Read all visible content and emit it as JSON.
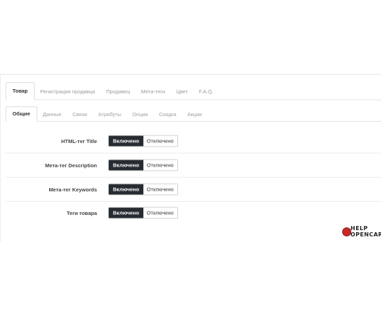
{
  "top_tabs": [
    {
      "label": "Товар",
      "active": true
    },
    {
      "label": "Регистрация продавца",
      "active": false
    },
    {
      "label": "Продавец",
      "active": false
    },
    {
      "label": "Мета-теги",
      "active": false
    },
    {
      "label": "Цвет",
      "active": false
    },
    {
      "label": "F.A.Q.",
      "active": false
    }
  ],
  "sub_tabs": [
    {
      "label": "Общие",
      "active": true
    },
    {
      "label": "Данные",
      "active": false
    },
    {
      "label": "Связи",
      "active": false
    },
    {
      "label": "Атрибуты",
      "active": false
    },
    {
      "label": "Опции",
      "active": false
    },
    {
      "label": "Скидка",
      "active": false
    },
    {
      "label": "Акции",
      "active": false
    }
  ],
  "settings": [
    {
      "label": "HTML-тег Title",
      "on_label": "Включено",
      "off_label": "Отключено",
      "selected": "on"
    },
    {
      "label": "Мета-тег Description",
      "on_label": "Включено",
      "off_label": "Отключено",
      "selected": "on"
    },
    {
      "label": "Мета-тег Keywords",
      "on_label": "Включено",
      "off_label": "Отключено",
      "selected": "on"
    },
    {
      "label": "Теги товара",
      "on_label": "Включено",
      "off_label": "Отключено",
      "selected": "on"
    }
  ],
  "logo": {
    "line1": "HELP",
    "line2": "OPENCART"
  },
  "colors": {
    "active_toggle": "#272c33",
    "border": "#e3e3e3",
    "logo_red": "#c62828"
  }
}
